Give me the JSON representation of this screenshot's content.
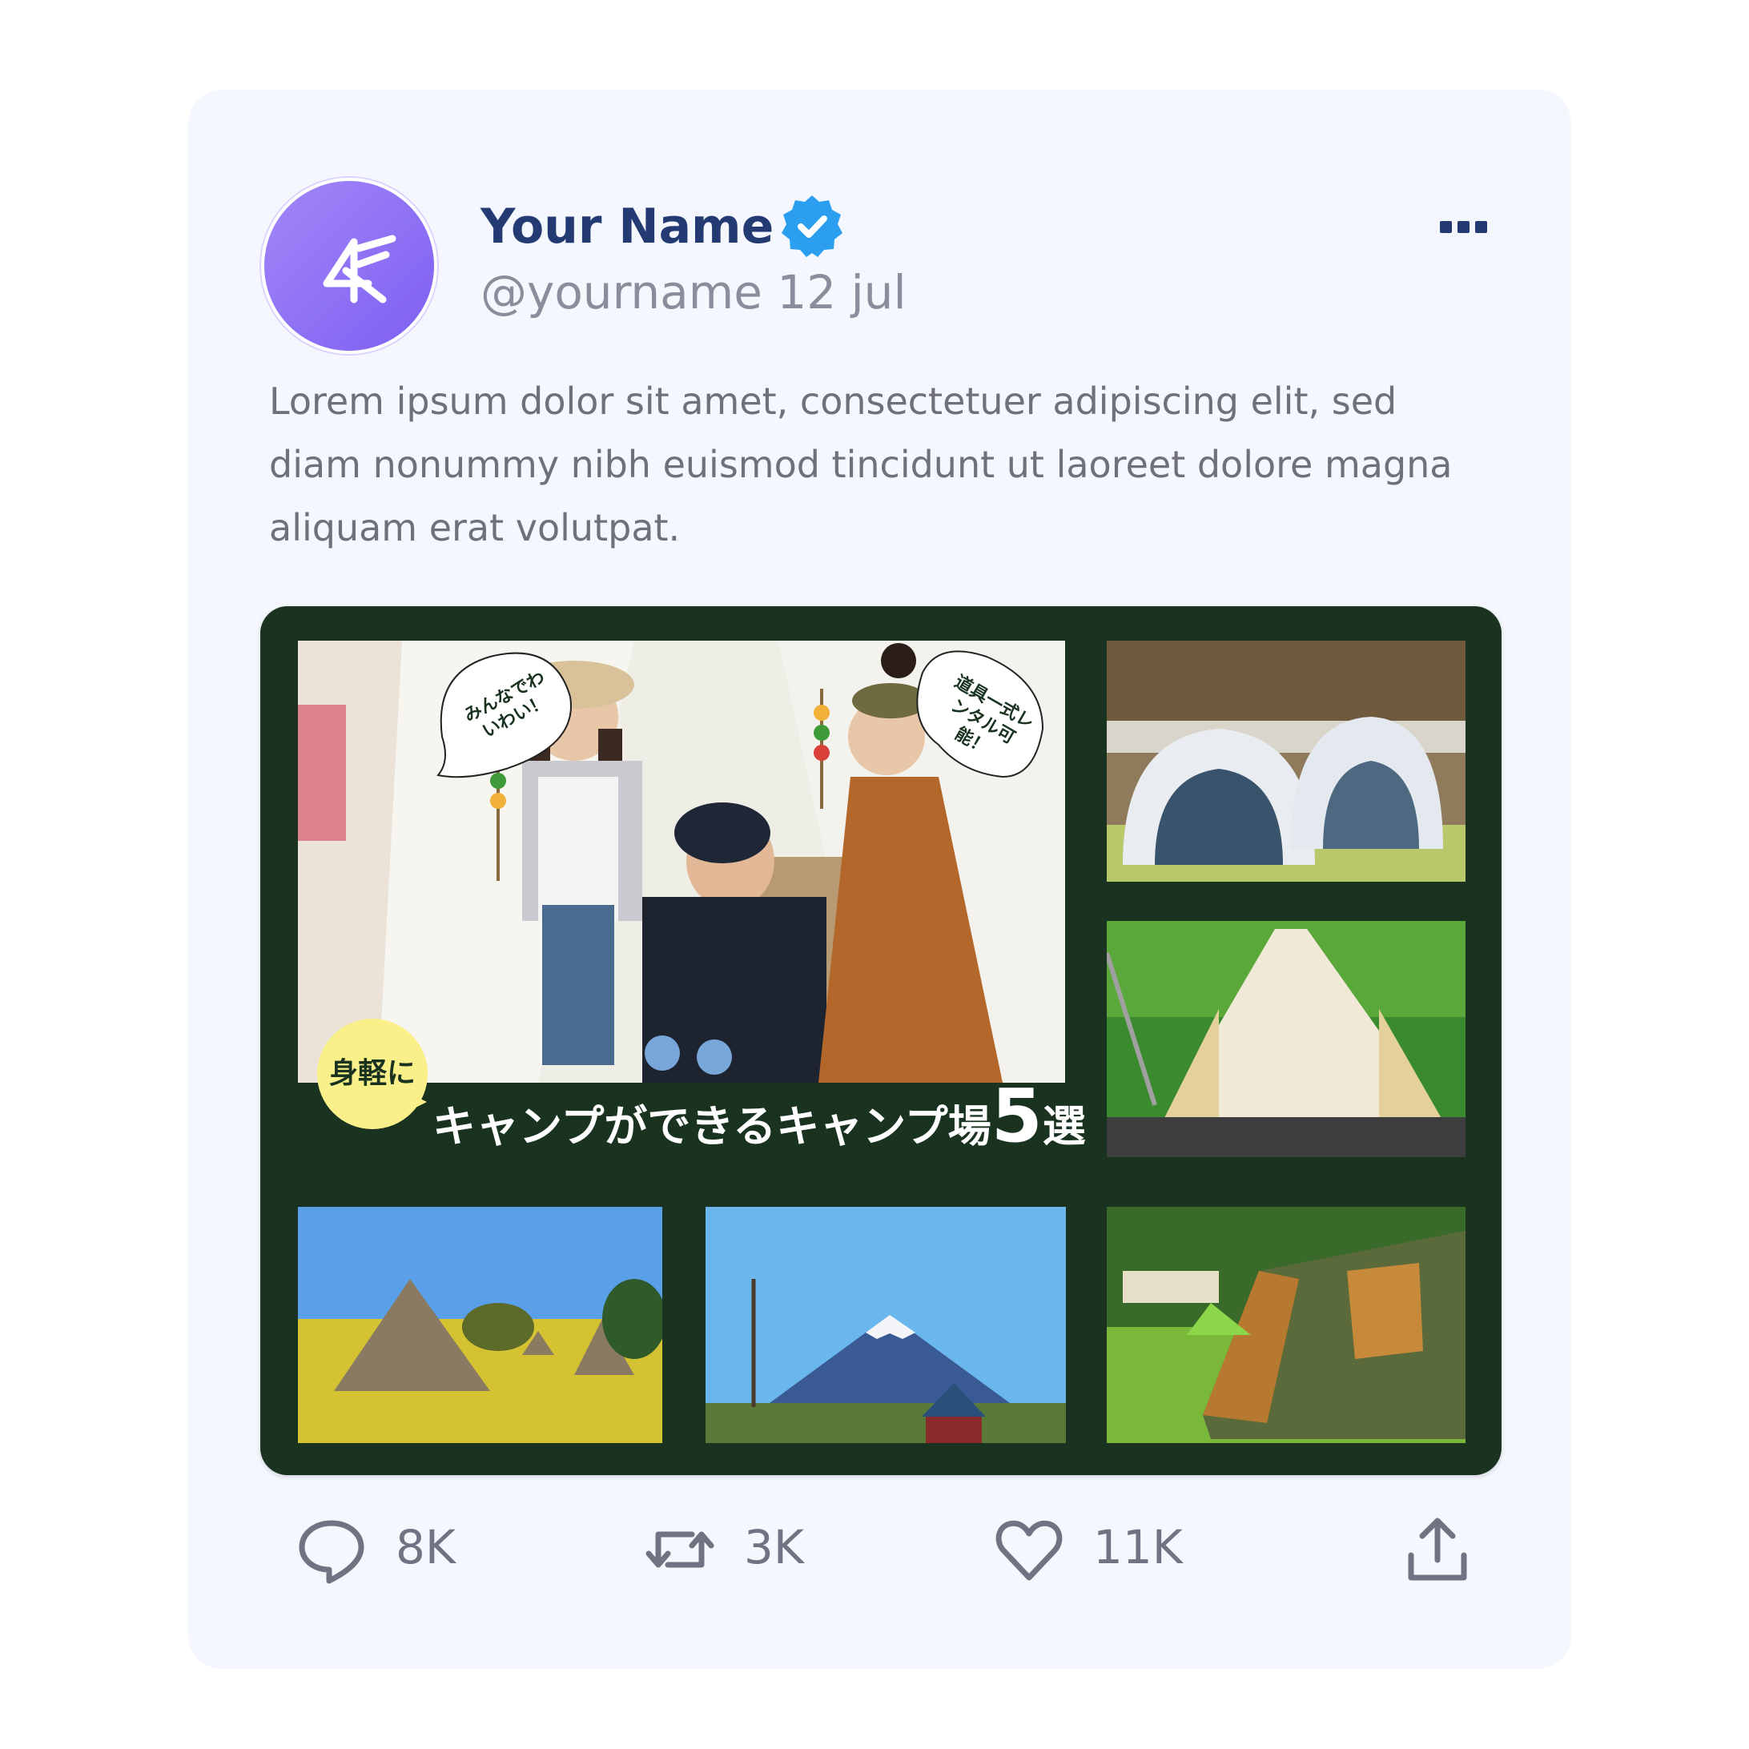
{
  "user": {
    "display_name": "Your Name",
    "handle": "@yourname",
    "date": "12 jul",
    "verified_icon": "verified-badge-icon",
    "avatar_icon": "brand-logo-icon"
  },
  "post": {
    "text": "Lorem ipsum dolor sit amet, consectetuer adipiscing elit, sed diam nonummy nibh euismod tincidunt ut laoreet dolore magna aliquam erat volutpat."
  },
  "media": {
    "callout_left": "みんなでわいわい！",
    "callout_right": "道具一式レンタル可能！",
    "badge": "身軽に",
    "headline_prefix": "キャンプができるキャンプ場",
    "headline_number": "5",
    "headline_suffix": "選",
    "colors": {
      "background": "#1a3320",
      "badge": "#faf08a"
    }
  },
  "actions": {
    "reply": {
      "icon": "comment-icon",
      "count": "8K"
    },
    "retweet": {
      "icon": "retweet-icon",
      "count": "3K"
    },
    "like": {
      "icon": "heart-icon",
      "count": "11K"
    },
    "share": {
      "icon": "share-icon"
    }
  },
  "colors": {
    "name": "#243a73",
    "verified": "#2b9ef0",
    "avatar": "#8a6df5"
  }
}
